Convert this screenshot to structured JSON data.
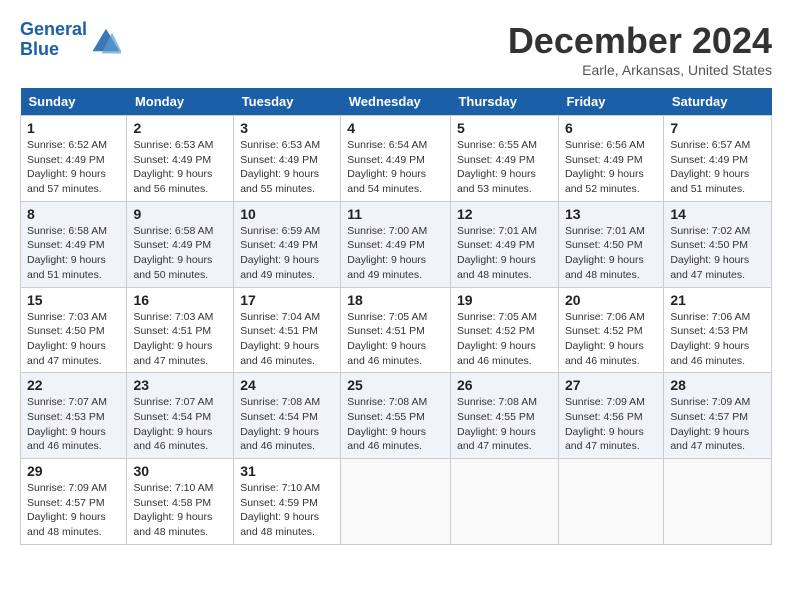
{
  "logo": {
    "line1": "General",
    "line2": "Blue"
  },
  "title": "December 2024",
  "location": "Earle, Arkansas, United States",
  "days_of_week": [
    "Sunday",
    "Monday",
    "Tuesday",
    "Wednesday",
    "Thursday",
    "Friday",
    "Saturday"
  ],
  "weeks": [
    [
      {
        "day": "1",
        "sunrise": "6:52 AM",
        "sunset": "4:49 PM",
        "daylight": "9 hours and 57 minutes."
      },
      {
        "day": "2",
        "sunrise": "6:53 AM",
        "sunset": "4:49 PM",
        "daylight": "9 hours and 56 minutes."
      },
      {
        "day": "3",
        "sunrise": "6:53 AM",
        "sunset": "4:49 PM",
        "daylight": "9 hours and 55 minutes."
      },
      {
        "day": "4",
        "sunrise": "6:54 AM",
        "sunset": "4:49 PM",
        "daylight": "9 hours and 54 minutes."
      },
      {
        "day": "5",
        "sunrise": "6:55 AM",
        "sunset": "4:49 PM",
        "daylight": "9 hours and 53 minutes."
      },
      {
        "day": "6",
        "sunrise": "6:56 AM",
        "sunset": "4:49 PM",
        "daylight": "9 hours and 52 minutes."
      },
      {
        "day": "7",
        "sunrise": "6:57 AM",
        "sunset": "4:49 PM",
        "daylight": "9 hours and 51 minutes."
      }
    ],
    [
      {
        "day": "8",
        "sunrise": "6:58 AM",
        "sunset": "4:49 PM",
        "daylight": "9 hours and 51 minutes."
      },
      {
        "day": "9",
        "sunrise": "6:58 AM",
        "sunset": "4:49 PM",
        "daylight": "9 hours and 50 minutes."
      },
      {
        "day": "10",
        "sunrise": "6:59 AM",
        "sunset": "4:49 PM",
        "daylight": "9 hours and 49 minutes."
      },
      {
        "day": "11",
        "sunrise": "7:00 AM",
        "sunset": "4:49 PM",
        "daylight": "9 hours and 49 minutes."
      },
      {
        "day": "12",
        "sunrise": "7:01 AM",
        "sunset": "4:49 PM",
        "daylight": "9 hours and 48 minutes."
      },
      {
        "day": "13",
        "sunrise": "7:01 AM",
        "sunset": "4:50 PM",
        "daylight": "9 hours and 48 minutes."
      },
      {
        "day": "14",
        "sunrise": "7:02 AM",
        "sunset": "4:50 PM",
        "daylight": "9 hours and 47 minutes."
      }
    ],
    [
      {
        "day": "15",
        "sunrise": "7:03 AM",
        "sunset": "4:50 PM",
        "daylight": "9 hours and 47 minutes."
      },
      {
        "day": "16",
        "sunrise": "7:03 AM",
        "sunset": "4:51 PM",
        "daylight": "9 hours and 47 minutes."
      },
      {
        "day": "17",
        "sunrise": "7:04 AM",
        "sunset": "4:51 PM",
        "daylight": "9 hours and 46 minutes."
      },
      {
        "day": "18",
        "sunrise": "7:05 AM",
        "sunset": "4:51 PM",
        "daylight": "9 hours and 46 minutes."
      },
      {
        "day": "19",
        "sunrise": "7:05 AM",
        "sunset": "4:52 PM",
        "daylight": "9 hours and 46 minutes."
      },
      {
        "day": "20",
        "sunrise": "7:06 AM",
        "sunset": "4:52 PM",
        "daylight": "9 hours and 46 minutes."
      },
      {
        "day": "21",
        "sunrise": "7:06 AM",
        "sunset": "4:53 PM",
        "daylight": "9 hours and 46 minutes."
      }
    ],
    [
      {
        "day": "22",
        "sunrise": "7:07 AM",
        "sunset": "4:53 PM",
        "daylight": "9 hours and 46 minutes."
      },
      {
        "day": "23",
        "sunrise": "7:07 AM",
        "sunset": "4:54 PM",
        "daylight": "9 hours and 46 minutes."
      },
      {
        "day": "24",
        "sunrise": "7:08 AM",
        "sunset": "4:54 PM",
        "daylight": "9 hours and 46 minutes."
      },
      {
        "day": "25",
        "sunrise": "7:08 AM",
        "sunset": "4:55 PM",
        "daylight": "9 hours and 46 minutes."
      },
      {
        "day": "26",
        "sunrise": "7:08 AM",
        "sunset": "4:55 PM",
        "daylight": "9 hours and 47 minutes."
      },
      {
        "day": "27",
        "sunrise": "7:09 AM",
        "sunset": "4:56 PM",
        "daylight": "9 hours and 47 minutes."
      },
      {
        "day": "28",
        "sunrise": "7:09 AM",
        "sunset": "4:57 PM",
        "daylight": "9 hours and 47 minutes."
      }
    ],
    [
      {
        "day": "29",
        "sunrise": "7:09 AM",
        "sunset": "4:57 PM",
        "daylight": "9 hours and 48 minutes."
      },
      {
        "day": "30",
        "sunrise": "7:10 AM",
        "sunset": "4:58 PM",
        "daylight": "9 hours and 48 minutes."
      },
      {
        "day": "31",
        "sunrise": "7:10 AM",
        "sunset": "4:59 PM",
        "daylight": "9 hours and 48 minutes."
      },
      null,
      null,
      null,
      null
    ]
  ],
  "labels": {
    "sunrise": "Sunrise:",
    "sunset": "Sunset:",
    "daylight": "Daylight:"
  }
}
